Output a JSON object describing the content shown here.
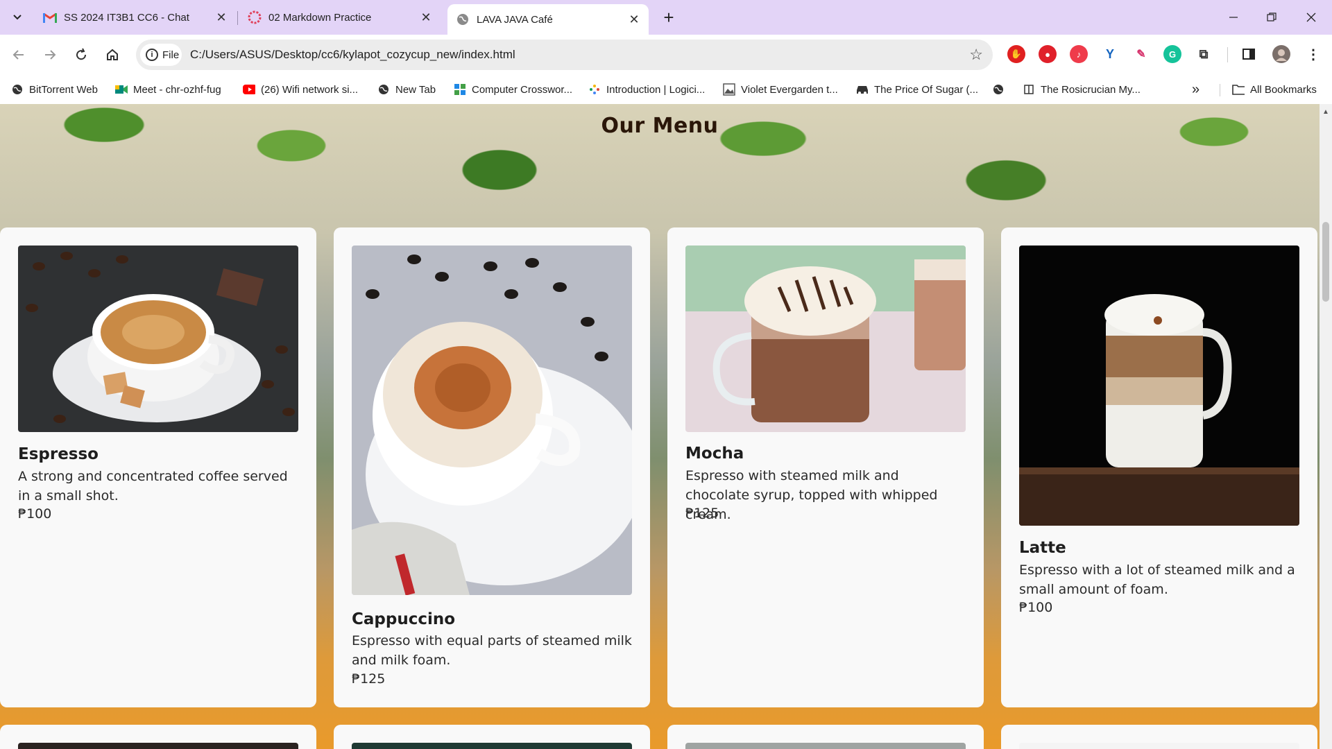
{
  "browser": {
    "tabs": [
      {
        "title": "SS 2024 IT3B1 CC6 - Chat",
        "icon": "gmail-icon",
        "active": false
      },
      {
        "title": "02 Markdown Practice",
        "icon": "notion-like-icon",
        "active": false
      },
      {
        "title": "LAVA JAVA Café",
        "icon": "globe-icon",
        "active": true
      }
    ],
    "close_glyph": "✕",
    "new_tab_glyph": "+",
    "address": {
      "chip_label": "File",
      "url": "C:/Users/ASUS/Desktop/cc6/kylapot_cozycup_new/index.html"
    },
    "bookmarks": [
      {
        "label": "BitTorrent Web",
        "icon": "globe-icon"
      },
      {
        "label": "Meet - chr-ozhf-fug",
        "icon": "meet-icon"
      },
      {
        "label": "(26) Wifi network si...",
        "icon": "youtube-icon"
      },
      {
        "label": "New Tab",
        "icon": "globe-icon"
      },
      {
        "label": "Computer Crosswor...",
        "icon": "grid-icon"
      },
      {
        "label": "Introduction | Logici...",
        "icon": "dots-icon"
      },
      {
        "label": "Violet Evergarden t...",
        "icon": "image-icon"
      },
      {
        "label": "The Price Of Sugar (...",
        "icon": "car-icon"
      },
      {
        "label": "",
        "icon": "globe-icon"
      },
      {
        "label": "The Rosicrucian My...",
        "icon": "book-icon"
      }
    ],
    "all_bookmarks_label": "All Bookmarks"
  },
  "page": {
    "section_title": "Our Menu",
    "menu_items": [
      {
        "name": "Espresso",
        "description": "A strong and concentrated coffee served in a small shot.",
        "price": "₱100"
      },
      {
        "name": "Cappuccino",
        "description": "Espresso with equal parts of steamed milk and milk foam.",
        "price": "₱125"
      },
      {
        "name": "Mocha",
        "description": "Espresso with steamed milk and chocolate syrup, topped with whipped cream.",
        "price": "₱125"
      },
      {
        "name": "Latte",
        "description": "Espresso with a lot of steamed milk and a small amount of foam.",
        "price": "₱100"
      }
    ]
  },
  "colors": {
    "tabstrip": "#e3d4f7",
    "card_bg": "#f9f9f9",
    "title_text": "#2a1608"
  }
}
